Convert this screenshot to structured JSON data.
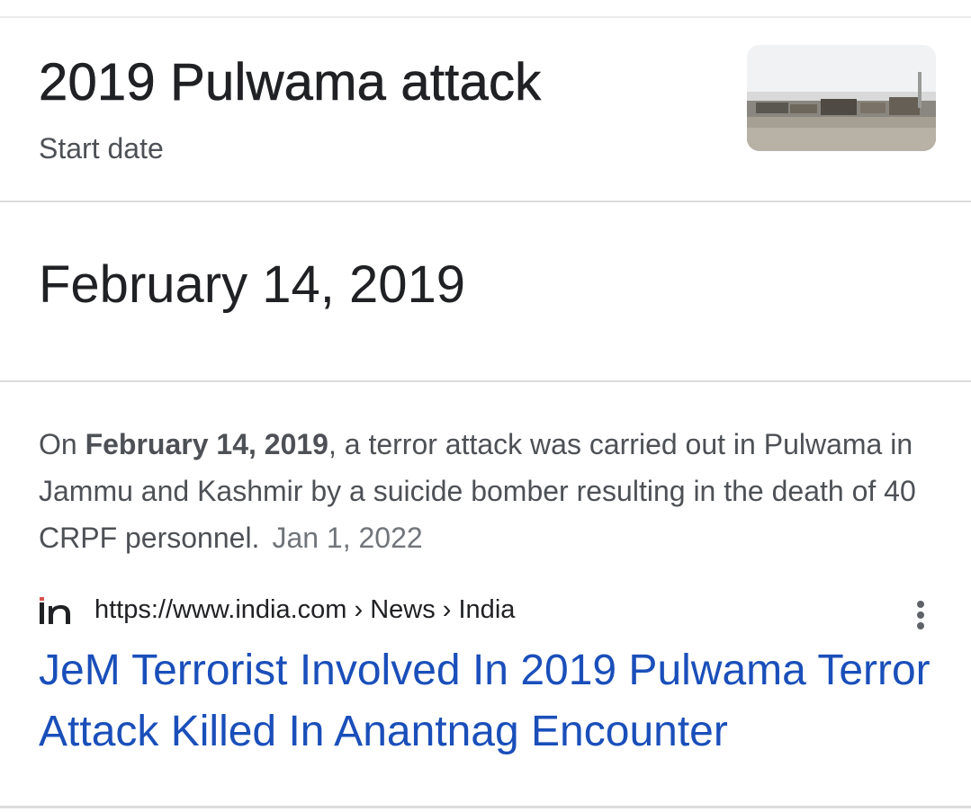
{
  "knowledge_panel": {
    "title": "2019 Pulwama attack",
    "subtitle": "Start date",
    "answer": "February 14, 2019"
  },
  "snippet": {
    "prefix": "On ",
    "bold": "February 14, 2019",
    "suffix": ", a terror attack was carried out in Pulwama in Jammu and Kashmir by a suicide bomber resulting in the death of 40 CRPF personnel.",
    "date": "Jan 1, 2022"
  },
  "result": {
    "favicon_icon": "india-com-logo-icon",
    "url": "https://www.india.com › News › India",
    "title": "JeM Terrorist Involved In 2019 Pulwama Terror Attack Killed In Anantnag Encounter",
    "menu_icon": "more-vert-icon"
  },
  "colors": {
    "link": "#1a4fba",
    "text": "#202124",
    "secondary_text": "#4d5156",
    "divider": "#dcdcdc"
  }
}
